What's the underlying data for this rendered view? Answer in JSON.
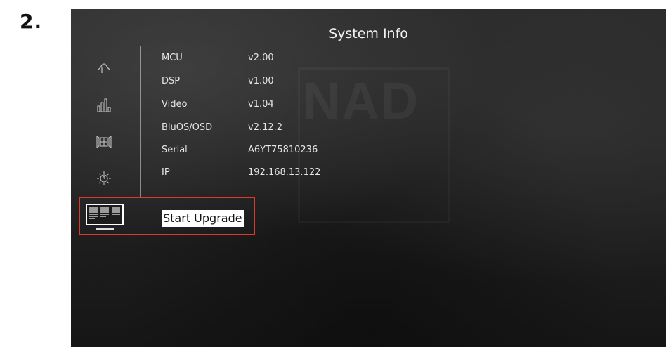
{
  "step": {
    "label": "2."
  },
  "screen": {
    "title": "System Info",
    "watermark": "NAD",
    "nav_icons": [
      {
        "name": "waveform-icon"
      },
      {
        "name": "equalizer-icon"
      },
      {
        "name": "speaker-setup-icon"
      },
      {
        "name": "settings-gear-icon"
      }
    ],
    "info": [
      {
        "label": "MCU",
        "value": "v2.00"
      },
      {
        "label": "DSP",
        "value": "v1.00"
      },
      {
        "label": "Video",
        "value": "v1.04"
      },
      {
        "label": "BluOS/OSD",
        "value": "v2.12.2"
      },
      {
        "label": "Serial",
        "value": "A6YT75810236"
      },
      {
        "label": "IP",
        "value": "192.168.13.122"
      }
    ],
    "upgrade": {
      "icon": "system-info-monitor-icon",
      "button_label": "Start Upgrade",
      "highlight_color": "#d93a2b"
    }
  }
}
